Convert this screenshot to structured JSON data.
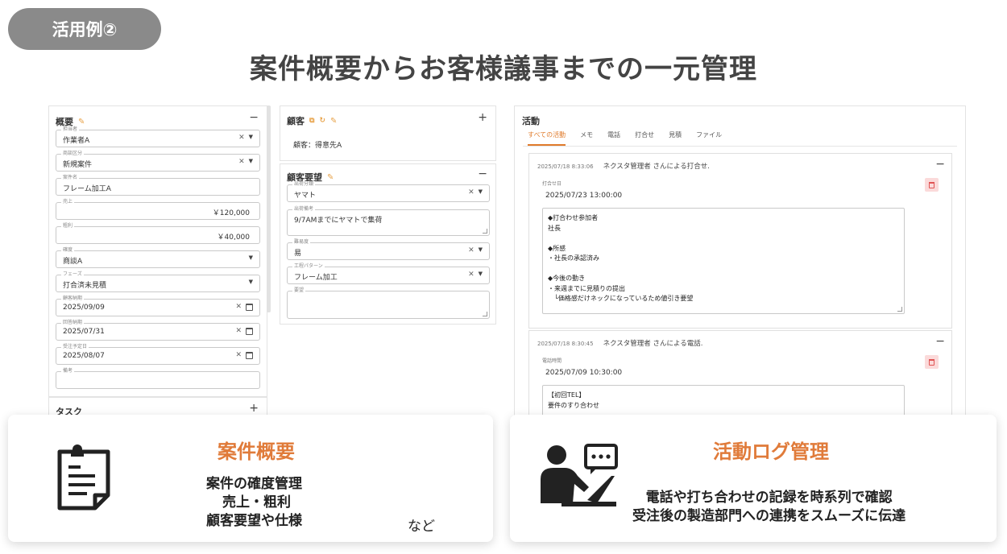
{
  "badge": "活用例②",
  "headline": "案件概要からお客様議事までの一元管理",
  "overview": {
    "title": "概要",
    "fields": [
      {
        "label": "担当者",
        "value": "作業者A"
      },
      {
        "label": "商談区分",
        "value": "新規案件"
      },
      {
        "label": "案件名",
        "value": "フレーム加工A"
      },
      {
        "label": "売上",
        "value": "￥120,000"
      },
      {
        "label": "粗利",
        "value": "￥40,000"
      },
      {
        "label": "確度",
        "value": "商談A"
      },
      {
        "label": "フェーズ",
        "value": "打合済未見積"
      },
      {
        "label": "顧客納期",
        "value": "2025/09/09"
      },
      {
        "label": "回答納期",
        "value": "2025/07/31"
      },
      {
        "label": "受注予定日",
        "value": "2025/08/07"
      },
      {
        "label": "備考",
        "value": ""
      }
    ],
    "task_title": "タスク"
  },
  "customer": {
    "title": "顧客",
    "value": "顧客：得意先A"
  },
  "request": {
    "title": "顧客要望",
    "fields": [
      {
        "label": "出荷分類",
        "value": "ヤマト"
      },
      {
        "label": "出荷備考",
        "value": "9/7AMまでにヤマトで集荷"
      },
      {
        "label": "難易度",
        "value": "易"
      },
      {
        "label": "工程パターン",
        "value": "フレーム加工"
      },
      {
        "label": "要望",
        "value": ""
      }
    ]
  },
  "activity": {
    "title": "活動",
    "tabs": [
      "すべての活動",
      "メモ",
      "電話",
      "打合せ",
      "見積",
      "ファイル"
    ],
    "entries": [
      {
        "time": "2025/07/18 8:33:06",
        "who": "ネクスタ管理者 さんによる打合せ.",
        "date_label": "打合せ日",
        "date": "2025/07/23 13:00:00",
        "memo": [
          "◆打合わせ参加者",
          "社長",
          "",
          "◆所感",
          "・社長の承認済み",
          "",
          "◆今後の動き",
          "・来週までに見積りの提出",
          "　└価格感だけネックになっているため値引き要望"
        ]
      },
      {
        "time": "2025/07/18 8:30:45",
        "who": "ネクスタ管理者 さんによる電話.",
        "date_label": "電話時間",
        "date": "2025/07/09 10:30:00",
        "memo": [
          "【初回TEL】",
          "要件のすり合わせ"
        ]
      }
    ]
  },
  "cards": {
    "left": {
      "title": "案件概要",
      "lines": [
        "案件の確度管理",
        "売上・粗利",
        "顧客要望や仕様"
      ],
      "etc": "など"
    },
    "right": {
      "title": "活動ログ管理",
      "lines": [
        "電話や打ち合わせの記録を時系列で確認",
        "受注後の製造部門への連携をスムーズに伝達"
      ]
    }
  },
  "colors": {
    "accent": "#e07b3a",
    "badge": "#8a8a8a"
  }
}
